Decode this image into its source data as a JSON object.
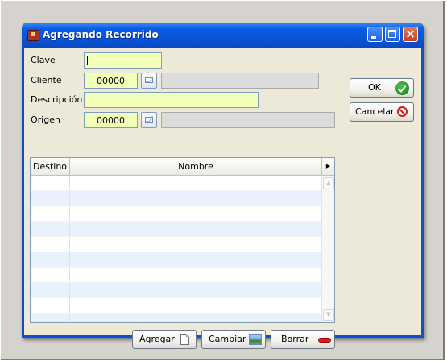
{
  "window": {
    "title": "Agregando Recorrido"
  },
  "form": {
    "clave": {
      "label": "Clave",
      "value": ""
    },
    "cliente": {
      "label": "Cliente",
      "code": "00000",
      "name": ""
    },
    "descripcion": {
      "label": "Descripción",
      "value": ""
    },
    "origen": {
      "label": "Origen",
      "code": "00000",
      "name": ""
    }
  },
  "actions": {
    "ok_label": "OK",
    "cancel_label": "Cancelar"
  },
  "grid": {
    "columns": [
      "Destino",
      "Nombre"
    ],
    "rows": []
  },
  "buttons": {
    "add": {
      "pre": "A",
      "mnemonic": "g",
      "post": "regar"
    },
    "change": {
      "pre": "Ca",
      "mnemonic": "m",
      "post": "biar"
    },
    "delete": {
      "pre": "",
      "mnemonic": "B",
      "post": "orrar"
    }
  },
  "colors": {
    "titlebar": "#0853d6",
    "editable_field": "#f2ffb8",
    "readonly_field": "#dcdcdc",
    "client_area": "#ece9d8",
    "alt_row": "#e8f2fd"
  }
}
